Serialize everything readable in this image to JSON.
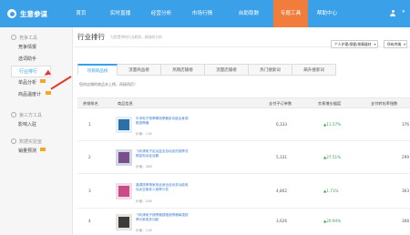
{
  "app": {
    "title": "生意参谋"
  },
  "nav": [
    "首页",
    "实时直播",
    "经营分析",
    "市场行情",
    "自助取数",
    "专题工具",
    "帮助中心"
  ],
  "sidebar": {
    "groups": [
      {
        "title": "竞争工具",
        "items": [
          "竞争情报",
          "选词助手",
          "行业排行",
          "单品分析",
          "商品温度计"
        ]
      },
      {
        "title": "第三方工具",
        "items": [
          "影响入驻"
        ]
      },
      {
        "title": "数据实验室",
        "items": [
          "销量预测"
        ]
      }
    ]
  },
  "main": {
    "title": "行业排行",
    "breadcrumb": "为您提供的行业趋势，精准的分析",
    "filter1": "个人护理/保健/按摩器材",
    "filter2": "所有终端",
    "tabs": [
      "热销商品榜",
      "流量商品榜",
      "热销店铺榜",
      "流量店铺榜",
      "热门搜索词",
      "飙升搜索词"
    ],
    "description": "您的店铺的商品本上榜，再接再厉！",
    "columns": [
      "热销排名",
      "商品信息",
      "支付子订单数",
      "交易增长幅度",
      "支付转化率指数"
    ],
    "rows": [
      {
        "rank": "1",
        "name": "丰沛电子按摩棒按摩器多功能全身颈椎按摩器",
        "price": "价格：118",
        "orders": "6,333",
        "growth": "11.57%",
        "conv": "376"
      },
      {
        "rank": "2",
        "name": "飞利浦电子足浴盆全自动加热按摩洗脚盆电动足浴器",
        "price": "价格：288",
        "orders": "5,331",
        "growth": "27.51%",
        "conv": "299"
      },
      {
        "rank": "3",
        "name": "晶源按摩椅家用全身全自动多功能电动太空舱老人按摩沙发",
        "price": "价格：108",
        "orders": "4,802",
        "growth": "1.71%",
        "conv": "363"
      },
      {
        "rank": "4",
        "name": "飞利浦电子按摩器颈椎按摩器肩颈按摩仪家用多功能",
        "price": "价格：118",
        "orders": "3,626",
        "growth": "20.94%",
        "conv": "308"
      }
    ]
  },
  "colors": {
    "topbar": "#3aa0e8",
    "active_nav": "#f07d3c",
    "arrow": "#e23b2e"
  },
  "icons": [
    "logo-icon",
    "user-icon",
    "arrow-annotation"
  ]
}
